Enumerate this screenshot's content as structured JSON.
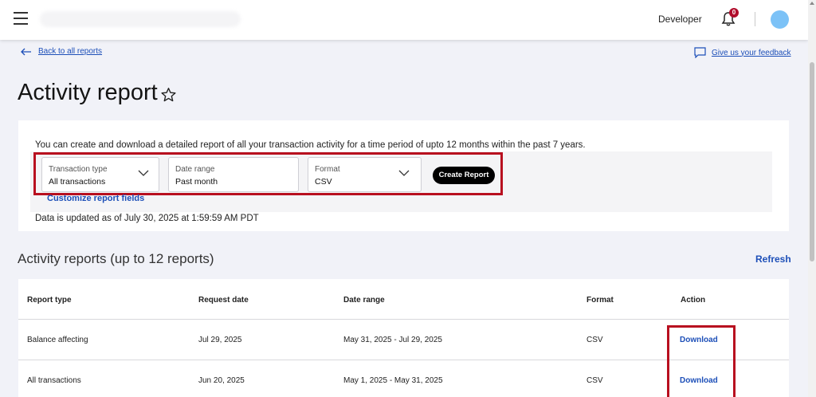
{
  "header": {
    "developer_label": "Developer",
    "notification_count": "0"
  },
  "nav": {
    "back_label": "Back to all reports",
    "feedback_label": "Give us your feedback"
  },
  "page": {
    "title": "Activity report"
  },
  "filters": {
    "description": "You can create and download a detailed report of all your transaction activity for a time period of upto 12 months within the past 7 years.",
    "transaction_type": {
      "label": "Transaction type",
      "value": "All transactions"
    },
    "date_range": {
      "label": "Date range",
      "value": "Past month"
    },
    "format": {
      "label": "Format",
      "value": "CSV"
    },
    "create_label": "Create Report",
    "customize_label": "Customize report fields",
    "updated_text": "Data is updated as of July 30, 2025 at 1:59:59 AM PDT"
  },
  "reports": {
    "title": "Activity reports (up to 12 reports)",
    "refresh_label": "Refresh",
    "columns": [
      "Report type",
      "Request date",
      "Date range",
      "Format",
      "Action"
    ],
    "rows": [
      {
        "type": "Balance affecting",
        "request_date": "Jul 29, 2025",
        "date_range": "May 31, 2025 - Jul 29, 2025",
        "format": "CSV",
        "action": "Download"
      },
      {
        "type": "All transactions",
        "request_date": "Jun 20, 2025",
        "date_range": "May 1, 2025 - May 31, 2025",
        "format": "CSV",
        "action": "Download"
      }
    ]
  },
  "colors": {
    "accent": "#1d4fb8",
    "highlight": "#b80f1f",
    "badge": "#b10d2c",
    "avatar": "#7cc2f7"
  }
}
